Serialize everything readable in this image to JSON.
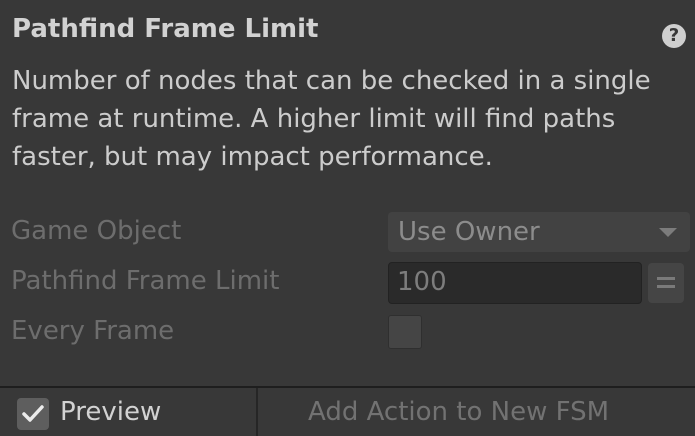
{
  "action": {
    "title": "Pathfind Frame Limit",
    "help_icon_glyph": "?",
    "description": "Number of nodes that can be checked in a single frame at runtime.  A higher limit will find paths faster, but may impact performance."
  },
  "fields": {
    "game_object": {
      "label": "Game Object",
      "value": "Use Owner"
    },
    "pathfind_frame_limit": {
      "label": "Pathfind Frame Limit",
      "value": "100"
    },
    "every_frame": {
      "label": "Every Frame",
      "checked": false
    }
  },
  "footer": {
    "preview_label": "Preview",
    "preview_checked": true,
    "add_action_label": "Add Action to New FSM"
  },
  "icons": {
    "help": "help-icon",
    "dropdown": "chevron-down-icon",
    "variable_toggle": "equals-icon",
    "check": "checkmark-icon"
  },
  "colors": {
    "background": "#383838",
    "title_text": "#d2d2d2",
    "disabled_label": "#6d6d6d",
    "field_dark": "#2a2a2a"
  }
}
